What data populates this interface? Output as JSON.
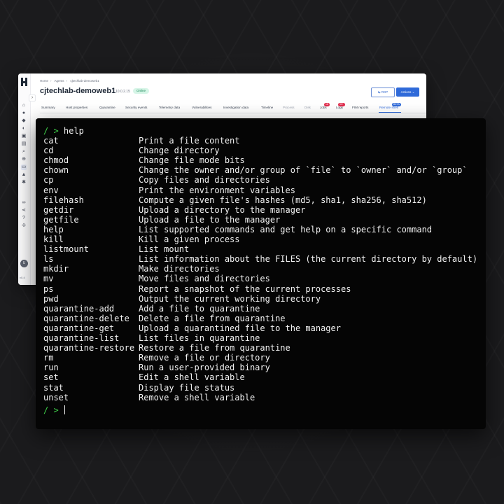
{
  "app": {
    "breadcrumb": [
      "Home",
      "Agents",
      "cjtechlab-demoweb1"
    ],
    "title": "cjtechlab-demoweb1",
    "ip": "10.0.2.15",
    "status": "Online",
    "rdp_label": "RDP",
    "actions_label": "Actions",
    "version": "v0.4",
    "avatar": "U",
    "tabs": [
      {
        "label": "Summary"
      },
      {
        "label": "Host properties"
      },
      {
        "label": "Quarantine"
      },
      {
        "label": "Security events"
      },
      {
        "label": "Telemetry data"
      },
      {
        "label": "Vulnerabilities"
      },
      {
        "label": "Investigation data"
      },
      {
        "label": "Timeline"
      },
      {
        "label": "Process"
      },
      {
        "label": "Disk"
      },
      {
        "label": "Jobs",
        "badge": "18"
      },
      {
        "label": "Logs",
        "badge": "99+"
      },
      {
        "label": "FIM reports"
      },
      {
        "label": "Remote shell",
        "badge": "BETA"
      }
    ]
  },
  "terminal": {
    "prompt": "/ >",
    "command": "help",
    "commands": [
      {
        "name": "cat",
        "desc": "Print a file content"
      },
      {
        "name": "cd",
        "desc": "Change directory"
      },
      {
        "name": "chmod",
        "desc": "Change file mode bits"
      },
      {
        "name": "chown",
        "desc": "Change the owner and/or group of `file` to `owner` and/or `group`"
      },
      {
        "name": "cp",
        "desc": "Copy files and directories"
      },
      {
        "name": "env",
        "desc": "Print the environment variables"
      },
      {
        "name": "filehash",
        "desc": "Compute a given file's hashes (md5, sha1, sha256, sha512)"
      },
      {
        "name": "getdir",
        "desc": "Upload a directory to the manager"
      },
      {
        "name": "getfile",
        "desc": "Upload a file to the manager"
      },
      {
        "name": "help",
        "desc": "List supported commands and get help on a specific command"
      },
      {
        "name": "kill",
        "desc": "Kill a given process"
      },
      {
        "name": "listmount",
        "desc": "List mount"
      },
      {
        "name": "ls",
        "desc": "List information about the FILES (the current directory by default)"
      },
      {
        "name": "mkdir",
        "desc": "Make directories"
      },
      {
        "name": "mv",
        "desc": "Move files and directories"
      },
      {
        "name": "ps",
        "desc": "Report a snapshot of the current processes"
      },
      {
        "name": "pwd",
        "desc": "Output the current working directory"
      },
      {
        "name": "quarantine-add",
        "desc": "Add a file to quarantine"
      },
      {
        "name": "quarantine-delete",
        "desc": "Delete a file from quarantine"
      },
      {
        "name": "quarantine-get",
        "desc": "Upload a quarantined file to the manager"
      },
      {
        "name": "quarantine-list",
        "desc": "List files in quarantine"
      },
      {
        "name": "quarantine-restore",
        "desc": "Restore a file from quarantine"
      },
      {
        "name": "rm",
        "desc": "Remove a file or directory"
      },
      {
        "name": "run",
        "desc": "Run a user-provided binary"
      },
      {
        "name": "set",
        "desc": "Edit a shell variable"
      },
      {
        "name": "stat",
        "desc": "Display file status"
      },
      {
        "name": "unset",
        "desc": "Remove a shell variable"
      }
    ]
  }
}
